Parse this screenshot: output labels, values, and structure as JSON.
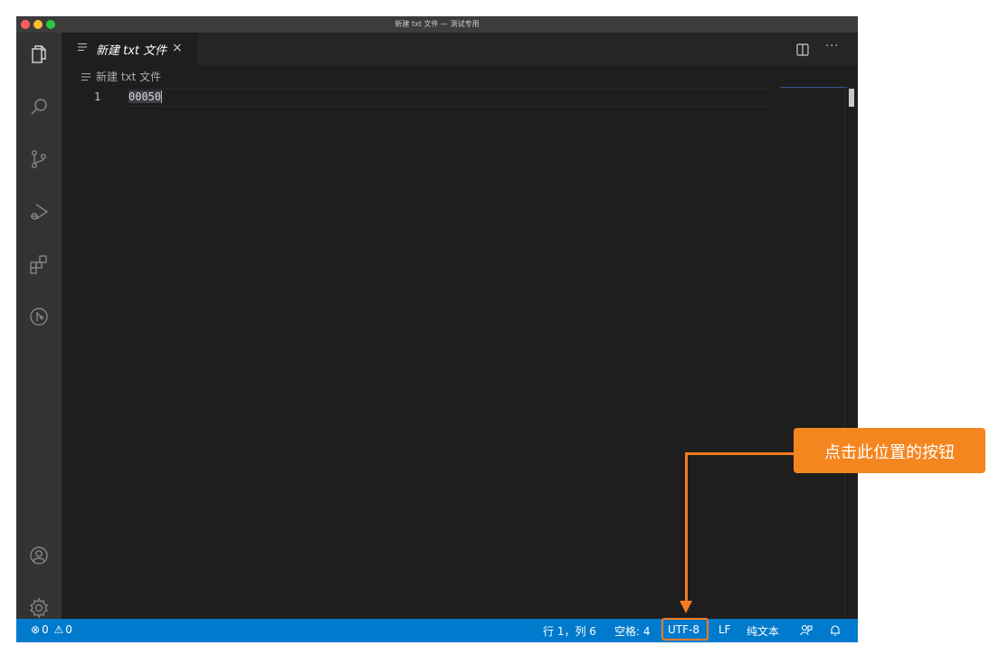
{
  "window": {
    "title": "新建 txt 文件 — 测试专用"
  },
  "activity_bar": {
    "icons": [
      "files-icon",
      "search-icon",
      "source-control-icon",
      "run-debug-icon",
      "extensions-icon",
      "gitlens-icon",
      "account-icon",
      "manage-gear-icon"
    ]
  },
  "tab": {
    "label": "新建 txt 文件",
    "close": "×"
  },
  "editor_actions": {
    "more": "···"
  },
  "breadcrumb": {
    "file": "新建 txt 文件"
  },
  "editor": {
    "lines": [
      {
        "number": "1",
        "text": "00050"
      }
    ]
  },
  "status_bar": {
    "errors": "0",
    "warnings": "0",
    "position": "行 1，列 6",
    "spaces": "空格: 4",
    "encoding": "UTF-8",
    "eol": "LF",
    "language": "纯文本",
    "error_symbol": "⊗",
    "warning_symbol": "⚠"
  },
  "annotation": {
    "text": "点击此位置的按钮",
    "color": "#f5861f"
  },
  "colors": {
    "status_bar": "#007acc",
    "editor_bg": "#1e1e1e",
    "activity_bar": "#333333"
  }
}
